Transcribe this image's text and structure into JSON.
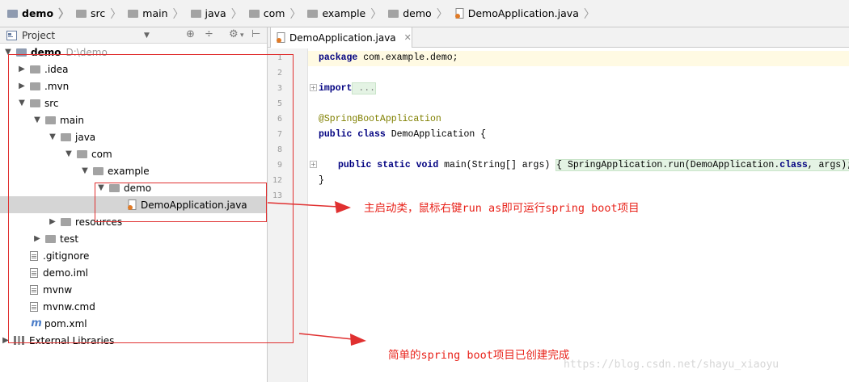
{
  "breadcrumb": [
    "demo",
    "src",
    "main",
    "java",
    "com",
    "example",
    "demo",
    "DemoApplication.java"
  ],
  "project_panel": {
    "title": "Project",
    "tree": [
      {
        "label": "demo",
        "path": "D:\\demo",
        "arrow": "▼",
        "icon": "module"
      },
      {
        "label": ".idea",
        "arrow": "▶",
        "icon": "folder"
      },
      {
        "label": ".mvn",
        "arrow": "▶",
        "icon": "folder"
      },
      {
        "label": "src",
        "arrow": "▼",
        "icon": "folder"
      },
      {
        "label": "main",
        "arrow": "▼",
        "icon": "folder"
      },
      {
        "label": "java",
        "arrow": "▼",
        "icon": "folder"
      },
      {
        "label": "com",
        "arrow": "▼",
        "icon": "folder"
      },
      {
        "label": "example",
        "arrow": "▼",
        "icon": "folder"
      },
      {
        "label": "demo",
        "arrow": "▼",
        "icon": "folder"
      },
      {
        "label": "DemoApplication.java",
        "arrow": "",
        "icon": "java"
      },
      {
        "label": "resources",
        "arrow": "▶",
        "icon": "folder"
      },
      {
        "label": "test",
        "arrow": "▶",
        "icon": "folder"
      },
      {
        "label": ".gitignore",
        "arrow": "",
        "icon": "file"
      },
      {
        "label": "demo.iml",
        "arrow": "",
        "icon": "file"
      },
      {
        "label": "mvnw",
        "arrow": "",
        "icon": "file"
      },
      {
        "label": "mvnw.cmd",
        "arrow": "",
        "icon": "file"
      },
      {
        "label": "pom.xml",
        "arrow": "",
        "icon": "maven"
      },
      {
        "label": "External Libraries",
        "arrow": "▶",
        "icon": "library"
      }
    ]
  },
  "editor": {
    "tab_label": "DemoApplication.java",
    "line_numbers": [
      "1",
      "2",
      "3",
      "5",
      "6",
      "7",
      "8",
      "9",
      "12",
      "13"
    ],
    "code": {
      "l1_kw": "package",
      "l1_rest": " com.example.demo;",
      "l3_kw": "import",
      "l3_fold": " ...",
      "l6_ann": "@SpringBootApplication",
      "l7_kw1": "public",
      "l7_kw2": "class",
      "l7_rest": " DemoApplication {",
      "l9_kw": "public static void",
      "l9_mid": " main(String[] args) ",
      "l9_body_open": "{",
      "l9_body": " SpringApplication.run(DemoApplication.",
      "l9_class": "class",
      "l9_body_end": ", args); ",
      "l9_body_close": "}",
      "l12": "}"
    }
  },
  "annotations": {
    "note1": "主启动类，鼠标右键run as即可运行spring boot项目",
    "note2": "简单的spring boot项目已创建完成",
    "watermark": "https://blog.csdn.net/shayu_xiaoyu",
    "color": "#e8231b"
  }
}
